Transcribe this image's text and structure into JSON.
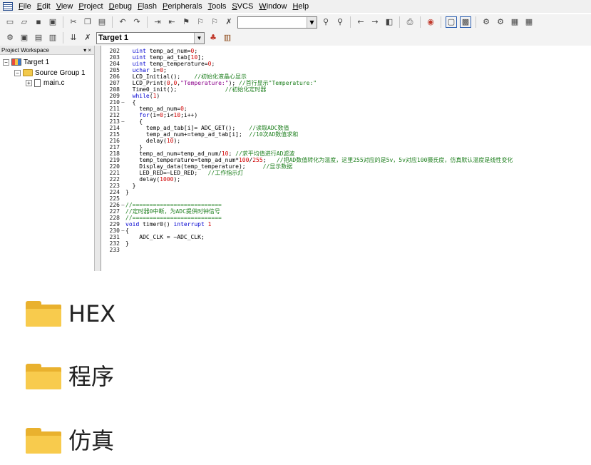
{
  "menubar": {
    "items": [
      {
        "acc": "F",
        "rest": "ile"
      },
      {
        "acc": "E",
        "rest": "dit"
      },
      {
        "acc": "V",
        "rest": "iew"
      },
      {
        "acc": "P",
        "rest": "roject"
      },
      {
        "acc": "D",
        "rest": "ebug"
      },
      {
        "acc": "F",
        "rest": "lash"
      },
      {
        "acc": "P",
        "rest": "eripherals"
      },
      {
        "acc": "T",
        "rest": "ools"
      },
      {
        "acc": "S",
        "rest": "VCS"
      },
      {
        "acc": "W",
        "rest": "indow"
      },
      {
        "acc": "H",
        "rest": "elp"
      }
    ]
  },
  "toolbar": {
    "target": "Target 1"
  },
  "workspace": {
    "title": "Project Workspace",
    "controls": "▾ ×",
    "tree": {
      "target": "Target 1",
      "group": "Source Group 1",
      "file": "main.c",
      "target_expander": "−",
      "group_expander": "−",
      "file_expander": "+"
    }
  },
  "editor": {
    "line_numbers": [
      "202",
      "203",
      "204",
      "205",
      "206",
      "207",
      "208",
      "209",
      "210",
      "211",
      "212",
      "213",
      "214",
      "215",
      "216",
      "217",
      "218",
      "219",
      "220",
      "221",
      "222",
      "223",
      "224",
      "225",
      "226",
      "227",
      "228",
      "229",
      "230",
      "231",
      "232",
      "233"
    ],
    "lines": [
      {
        "indent": "  ",
        "code": "uint temp_ad_num=0;"
      },
      {
        "indent": "  ",
        "code": "uint temp_ad_tab[10];"
      },
      {
        "indent": "  ",
        "code": "uint temp_temperature=0;"
      },
      {
        "indent": "  ",
        "code": "uchar i=0;"
      },
      {
        "indent": "  ",
        "code": "LCD_Initial();    ",
        "comment": "//初始化液晶心显示"
      },
      {
        "indent": "  ",
        "code": "LCD_Print(0,0,\"Temperature:\"); ",
        "comment": "//首行显示\"Temperature:\""
      },
      {
        "indent": "  ",
        "code": "Time0_init();              ",
        "comment": "//初始化定时器"
      },
      {
        "indent": "  ",
        "code": "while(1)"
      },
      {
        "indent": "  ",
        "code": "{"
      },
      {
        "indent": "    ",
        "code": "temp_ad_num=0;"
      },
      {
        "indent": "    ",
        "code": "for(i=0;i<10;i++)"
      },
      {
        "indent": "    ",
        "code": "{"
      },
      {
        "indent": "      ",
        "code": "temp_ad_tab[i]= ADC_GET();    ",
        "comment": "//读取ADC数值"
      },
      {
        "indent": "      ",
        "code": "temp_ad_num+=temp_ad_tab[i];  ",
        "comment": "//10次AD数值求和"
      },
      {
        "indent": "      ",
        "code": "delay(10);"
      },
      {
        "indent": "    ",
        "code": "}"
      },
      {
        "indent": "    ",
        "code": "temp_ad_num=temp_ad_num/10; ",
        "comment": "//求平均值进行AD滤波"
      },
      {
        "indent": "    ",
        "code": "temp_temperature=temp_ad_num*100/255;   ",
        "comment": "//把AD数值转化为温度，这里255对应的是5v，5v对应100摄氏度，仿真默认温度是线性变化"
      },
      {
        "indent": "    ",
        "code": "Display_data(temp_temperature);     ",
        "comment": "//显示数据"
      },
      {
        "indent": "    ",
        "code": "LED_RED=~LED_RED;   ",
        "comment": "//工作指示灯"
      },
      {
        "indent": "    ",
        "code": "delay(1000);"
      },
      {
        "indent": "  ",
        "code": "}"
      },
      {
        "indent": "",
        "code": "}"
      },
      {
        "indent": "",
        "code": ""
      },
      {
        "indent": "",
        "code": "",
        "comment": "//=========================="
      },
      {
        "indent": "",
        "code": "",
        "comment": "//定时器0中断，为ADC提供时钟信号"
      },
      {
        "indent": "",
        "code": "",
        "comment": "//=========================="
      },
      {
        "indent": "",
        "code": "void timer0() interrupt 1"
      },
      {
        "indent": "",
        "code": "{"
      },
      {
        "indent": "    ",
        "code": "ADC_CLK = ~ADC_CLK;"
      },
      {
        "indent": "",
        "code": "}"
      },
      {
        "indent": "",
        "code": ""
      }
    ]
  },
  "folders": [
    {
      "name": "HEX"
    },
    {
      "name": "程序"
    },
    {
      "name": "仿真"
    }
  ],
  "colors": {
    "keyword": "#0000d0",
    "comment": "#1d7f1d",
    "folder_front": "#f8cb4d",
    "folder_back": "#e9b12e"
  }
}
